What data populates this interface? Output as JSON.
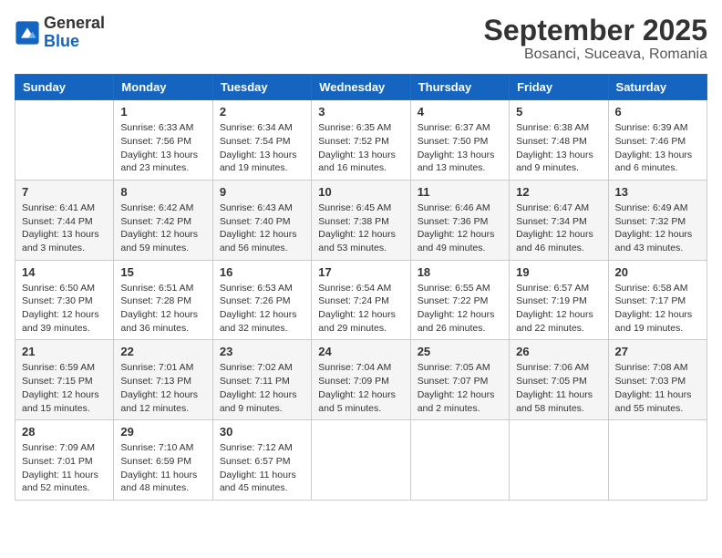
{
  "logo": {
    "general": "General",
    "blue": "Blue"
  },
  "header": {
    "month": "September 2025",
    "location": "Bosanci, Suceava, Romania"
  },
  "weekdays": [
    "Sunday",
    "Monday",
    "Tuesday",
    "Wednesday",
    "Thursday",
    "Friday",
    "Saturday"
  ],
  "weeks": [
    [
      {
        "day": "",
        "info": ""
      },
      {
        "day": "1",
        "info": "Sunrise: 6:33 AM\nSunset: 7:56 PM\nDaylight: 13 hours\nand 23 minutes."
      },
      {
        "day": "2",
        "info": "Sunrise: 6:34 AM\nSunset: 7:54 PM\nDaylight: 13 hours\nand 19 minutes."
      },
      {
        "day": "3",
        "info": "Sunrise: 6:35 AM\nSunset: 7:52 PM\nDaylight: 13 hours\nand 16 minutes."
      },
      {
        "day": "4",
        "info": "Sunrise: 6:37 AM\nSunset: 7:50 PM\nDaylight: 13 hours\nand 13 minutes."
      },
      {
        "day": "5",
        "info": "Sunrise: 6:38 AM\nSunset: 7:48 PM\nDaylight: 13 hours\nand 9 minutes."
      },
      {
        "day": "6",
        "info": "Sunrise: 6:39 AM\nSunset: 7:46 PM\nDaylight: 13 hours\nand 6 minutes."
      }
    ],
    [
      {
        "day": "7",
        "info": "Sunrise: 6:41 AM\nSunset: 7:44 PM\nDaylight: 13 hours\nand 3 minutes."
      },
      {
        "day": "8",
        "info": "Sunrise: 6:42 AM\nSunset: 7:42 PM\nDaylight: 12 hours\nand 59 minutes."
      },
      {
        "day": "9",
        "info": "Sunrise: 6:43 AM\nSunset: 7:40 PM\nDaylight: 12 hours\nand 56 minutes."
      },
      {
        "day": "10",
        "info": "Sunrise: 6:45 AM\nSunset: 7:38 PM\nDaylight: 12 hours\nand 53 minutes."
      },
      {
        "day": "11",
        "info": "Sunrise: 6:46 AM\nSunset: 7:36 PM\nDaylight: 12 hours\nand 49 minutes."
      },
      {
        "day": "12",
        "info": "Sunrise: 6:47 AM\nSunset: 7:34 PM\nDaylight: 12 hours\nand 46 minutes."
      },
      {
        "day": "13",
        "info": "Sunrise: 6:49 AM\nSunset: 7:32 PM\nDaylight: 12 hours\nand 43 minutes."
      }
    ],
    [
      {
        "day": "14",
        "info": "Sunrise: 6:50 AM\nSunset: 7:30 PM\nDaylight: 12 hours\nand 39 minutes."
      },
      {
        "day": "15",
        "info": "Sunrise: 6:51 AM\nSunset: 7:28 PM\nDaylight: 12 hours\nand 36 minutes."
      },
      {
        "day": "16",
        "info": "Sunrise: 6:53 AM\nSunset: 7:26 PM\nDaylight: 12 hours\nand 32 minutes."
      },
      {
        "day": "17",
        "info": "Sunrise: 6:54 AM\nSunset: 7:24 PM\nDaylight: 12 hours\nand 29 minutes."
      },
      {
        "day": "18",
        "info": "Sunrise: 6:55 AM\nSunset: 7:22 PM\nDaylight: 12 hours\nand 26 minutes."
      },
      {
        "day": "19",
        "info": "Sunrise: 6:57 AM\nSunset: 7:19 PM\nDaylight: 12 hours\nand 22 minutes."
      },
      {
        "day": "20",
        "info": "Sunrise: 6:58 AM\nSunset: 7:17 PM\nDaylight: 12 hours\nand 19 minutes."
      }
    ],
    [
      {
        "day": "21",
        "info": "Sunrise: 6:59 AM\nSunset: 7:15 PM\nDaylight: 12 hours\nand 15 minutes."
      },
      {
        "day": "22",
        "info": "Sunrise: 7:01 AM\nSunset: 7:13 PM\nDaylight: 12 hours\nand 12 minutes."
      },
      {
        "day": "23",
        "info": "Sunrise: 7:02 AM\nSunset: 7:11 PM\nDaylight: 12 hours\nand 9 minutes."
      },
      {
        "day": "24",
        "info": "Sunrise: 7:04 AM\nSunset: 7:09 PM\nDaylight: 12 hours\nand 5 minutes."
      },
      {
        "day": "25",
        "info": "Sunrise: 7:05 AM\nSunset: 7:07 PM\nDaylight: 12 hours\nand 2 minutes."
      },
      {
        "day": "26",
        "info": "Sunrise: 7:06 AM\nSunset: 7:05 PM\nDaylight: 11 hours\nand 58 minutes."
      },
      {
        "day": "27",
        "info": "Sunrise: 7:08 AM\nSunset: 7:03 PM\nDaylight: 11 hours\nand 55 minutes."
      }
    ],
    [
      {
        "day": "28",
        "info": "Sunrise: 7:09 AM\nSunset: 7:01 PM\nDaylight: 11 hours\nand 52 minutes."
      },
      {
        "day": "29",
        "info": "Sunrise: 7:10 AM\nSunset: 6:59 PM\nDaylight: 11 hours\nand 48 minutes."
      },
      {
        "day": "30",
        "info": "Sunrise: 7:12 AM\nSunset: 6:57 PM\nDaylight: 11 hours\nand 45 minutes."
      },
      {
        "day": "",
        "info": ""
      },
      {
        "day": "",
        "info": ""
      },
      {
        "day": "",
        "info": ""
      },
      {
        "day": "",
        "info": ""
      }
    ]
  ]
}
